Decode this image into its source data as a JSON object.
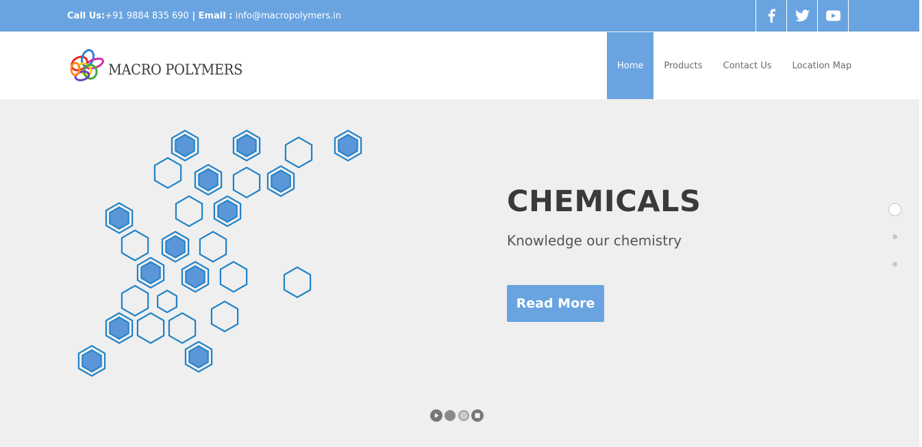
{
  "topbar": {
    "call_label": "Call Us:",
    "phone": "+91 9884 835 690",
    "separator": " | ",
    "email_label": "Email :",
    "email": " info@macropolymers.in",
    "social": [
      "facebook-icon",
      "twitter-icon",
      "youtube-icon"
    ]
  },
  "header": {
    "logo_text": "MACRO POLYMERS",
    "nav": [
      {
        "label": "Home",
        "active": true
      },
      {
        "label": "Products"
      },
      {
        "label": "Contact Us"
      },
      {
        "label": "Location Map"
      }
    ]
  },
  "hero": {
    "title": "CHEMICALS",
    "subtitle": "Knowledge our chemistry",
    "button": "Read More",
    "slides": 3,
    "active_slide": 1
  },
  "colors": {
    "accent": "#69a4e0",
    "hex_stroke": "#1f82c8",
    "hex_fill": "#5b97d8",
    "hero_bg": "#efefef"
  }
}
